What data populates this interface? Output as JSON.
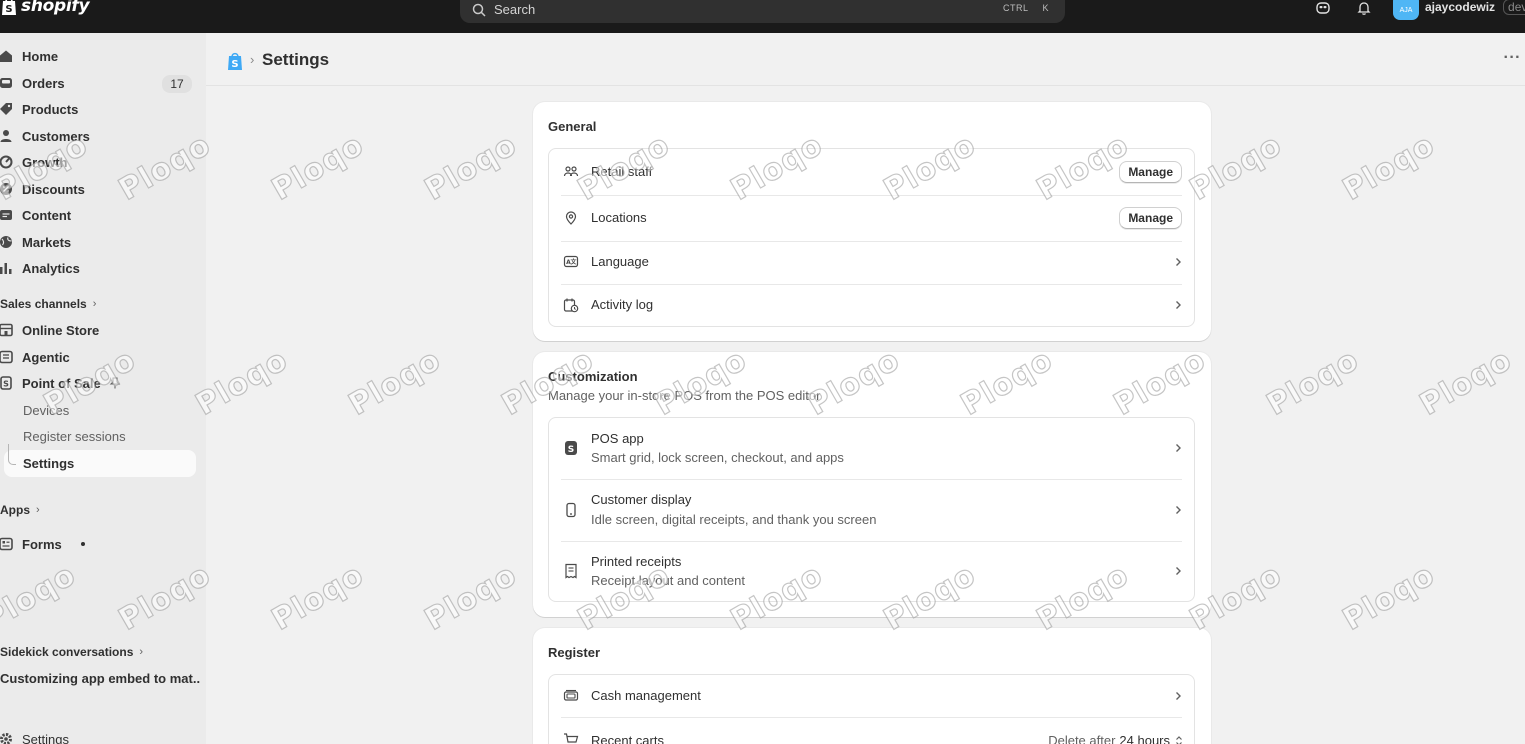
{
  "topbar": {
    "brand": "shopify",
    "search_placeholder": "Search",
    "shortcut_keys": [
      "CTRL",
      "K"
    ],
    "user_initials": "AJA",
    "user_name": "ajaycodewiz",
    "user_tag": "dev"
  },
  "sidebar": {
    "main_items": [
      {
        "label": "Home",
        "icon": "home-icon"
      },
      {
        "label": "Orders",
        "icon": "inbox-icon",
        "badge": "17"
      },
      {
        "label": "Products",
        "icon": "tag-icon"
      },
      {
        "label": "Customers",
        "icon": "person-icon"
      },
      {
        "label": "Growth",
        "icon": "gauge-icon"
      },
      {
        "label": "Discounts",
        "icon": "discount-icon"
      },
      {
        "label": "Content",
        "icon": "content-icon"
      },
      {
        "label": "Markets",
        "icon": "globe-icon"
      },
      {
        "label": "Analytics",
        "icon": "bar-chart-icon"
      }
    ],
    "sales_channels_label": "Sales channels",
    "channel_items": [
      {
        "label": "Online Store",
        "icon": "store-icon"
      },
      {
        "label": "Agentic",
        "icon": "agentic-icon"
      },
      {
        "label": "Point of Sale",
        "icon": "pos-icon"
      }
    ],
    "pos_subitems": [
      "Devices",
      "Register sessions",
      "Settings"
    ],
    "apps_label": "Apps",
    "app_items": [
      {
        "label": "Forms",
        "icon": "forms-icon"
      }
    ],
    "sidekick_label": "Sidekick conversations",
    "sidekick_item": "Customizing app embed to mat...",
    "settings_label": "Settings"
  },
  "header": {
    "title": "Settings",
    "more": "···"
  },
  "general": {
    "title": "General",
    "rows": [
      {
        "label": "Retail staff",
        "action": "Manage"
      },
      {
        "label": "Locations",
        "action": "Manage"
      },
      {
        "label": "Language"
      },
      {
        "label": "Activity log"
      }
    ]
  },
  "customization": {
    "title": "Customization",
    "subtitle": "Manage your in-store POS from the POS editor",
    "rows": [
      {
        "label": "POS app",
        "desc": "Smart grid, lock screen, checkout, and apps"
      },
      {
        "label": "Customer display",
        "desc": "Idle screen, digital receipts, and thank you screen"
      },
      {
        "label": "Printed receipts",
        "desc": "Receipt layout and content"
      }
    ]
  },
  "register": {
    "title": "Register",
    "rows": [
      {
        "label": "Cash management"
      },
      {
        "label": "Recent carts",
        "value_prefix": "Delete after",
        "value": "24 hours"
      }
    ]
  },
  "watermark": "Ploqo"
}
